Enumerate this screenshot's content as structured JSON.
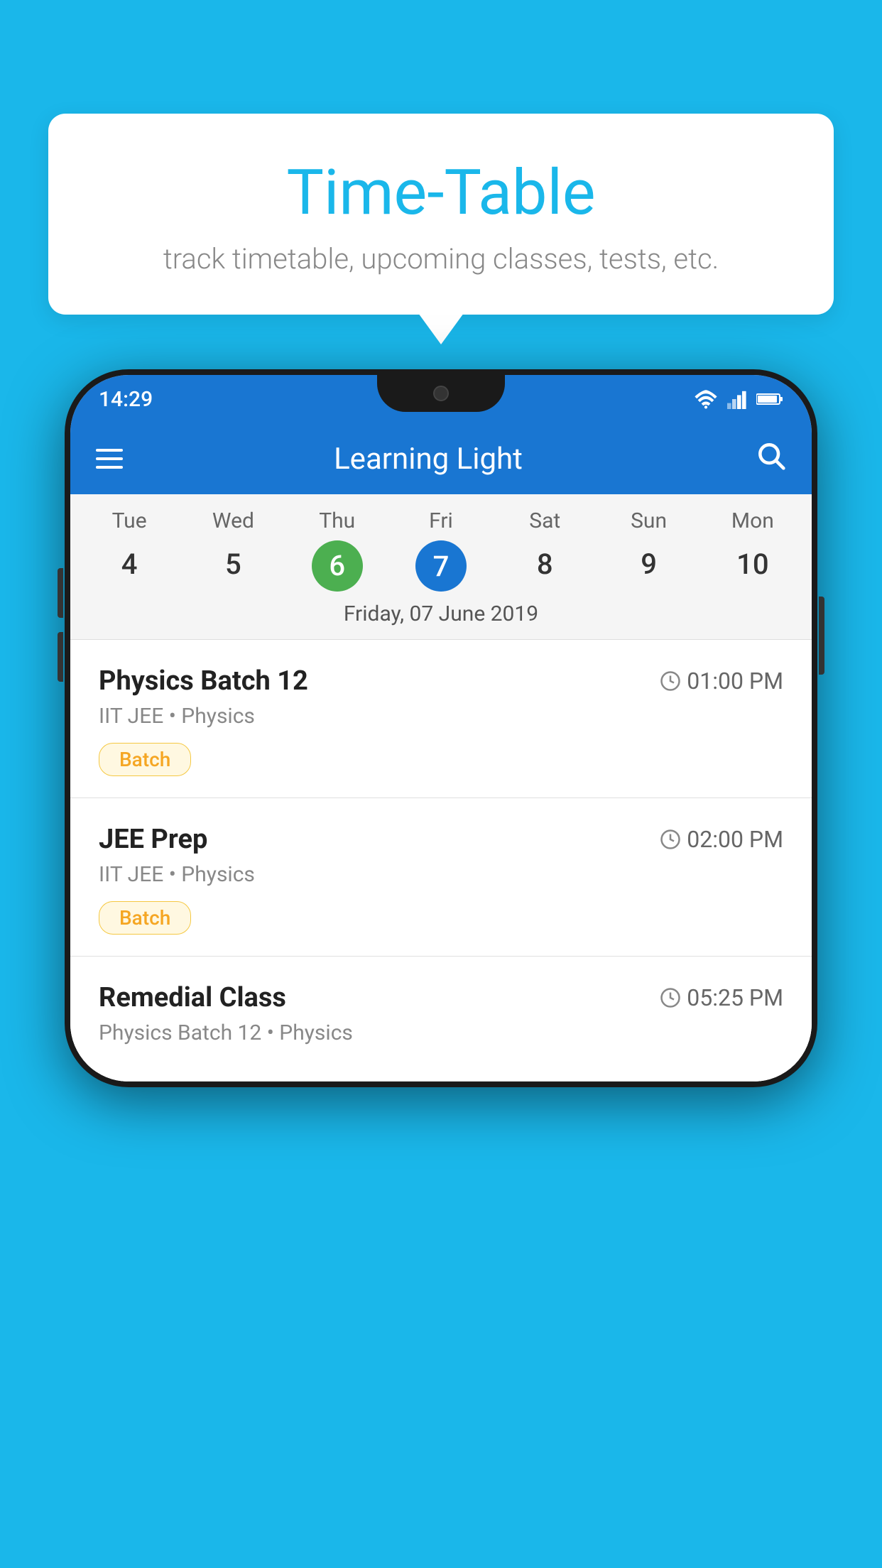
{
  "background_color": "#1ab7ea",
  "bubble": {
    "title": "Time-Table",
    "subtitle": "track timetable, upcoming classes, tests, etc."
  },
  "app": {
    "name": "Learning Light",
    "status_time": "14:29"
  },
  "calendar": {
    "days": [
      {
        "short": "Tue",
        "num": "4"
      },
      {
        "short": "Wed",
        "num": "5"
      },
      {
        "short": "Thu",
        "num": "6",
        "state": "today"
      },
      {
        "short": "Fri",
        "num": "7",
        "state": "selected"
      },
      {
        "short": "Sat",
        "num": "8"
      },
      {
        "short": "Sun",
        "num": "9"
      },
      {
        "short": "Mon",
        "num": "10"
      }
    ],
    "selected_date_label": "Friday, 07 June 2019"
  },
  "classes": [
    {
      "name": "Physics Batch 12",
      "time": "01:00 PM",
      "meta": "IIT JEE • Physics",
      "badge": "Batch"
    },
    {
      "name": "JEE Prep",
      "time": "02:00 PM",
      "meta": "IIT JEE • Physics",
      "badge": "Batch"
    },
    {
      "name": "Remedial Class",
      "time": "05:25 PM",
      "meta": "Physics Batch 12 • Physics",
      "badge": ""
    }
  ],
  "buttons": {
    "hamburger_label": "menu",
    "search_label": "search"
  }
}
